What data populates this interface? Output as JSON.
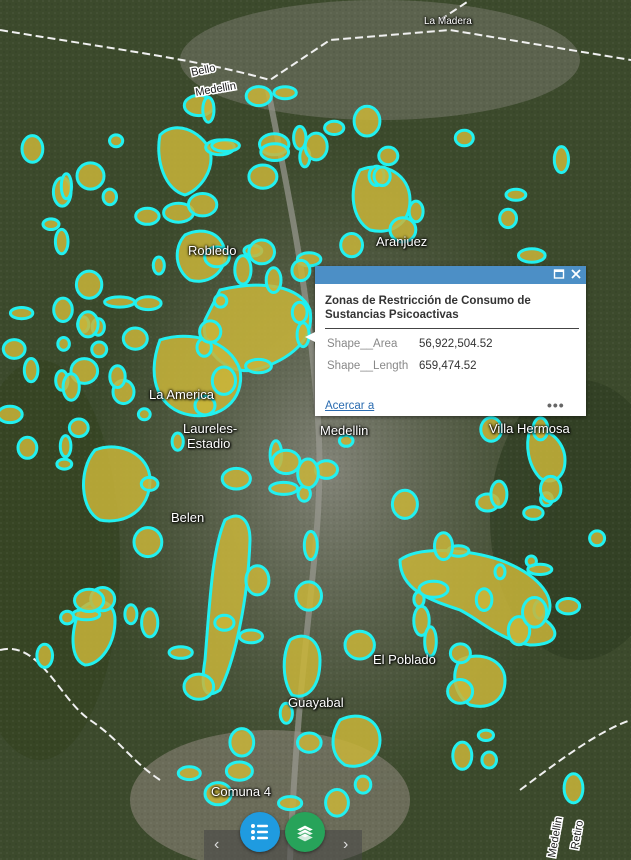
{
  "map": {
    "places": [
      {
        "id": "la-madera",
        "text": "La Madera"
      },
      {
        "id": "robledo",
        "text": "Robledo"
      },
      {
        "id": "aranjuez",
        "text": "Aranjuez"
      },
      {
        "id": "la-america",
        "text": "La America"
      },
      {
        "id": "laureles-1",
        "text": "Laureles-"
      },
      {
        "id": "laureles-2",
        "text": "Estadio"
      },
      {
        "id": "medellin",
        "text": "Medellin"
      },
      {
        "id": "villa-hermosa",
        "text": "Villa Hermosa"
      },
      {
        "id": "belen",
        "text": "Belen"
      },
      {
        "id": "el-poblado",
        "text": "El Poblado"
      },
      {
        "id": "guayabal",
        "text": "Guayabal"
      },
      {
        "id": "comuna-4",
        "text": "Comuna 4"
      }
    ],
    "roads": {
      "bello": "Bello",
      "medellin_top": "Medellin",
      "medellin_right": "Medellin",
      "retiro": "Retiro"
    },
    "colors": {
      "zone_fill": "#c9b53a",
      "zone_outline": "#22f0f0",
      "popup_header": "#4c8fc6"
    }
  },
  "popup": {
    "title": "Zonas de Restricción de Consumo de Sustancias Psicoactivas",
    "attributes": [
      {
        "key": "Shape__Area",
        "value": "56,922,504.52"
      },
      {
        "key": "Shape__Length",
        "value": "659,474.52"
      }
    ],
    "zoom_link": "Acercar a",
    "more": "•••",
    "maximize_icon": "maximize-icon",
    "close_icon": "close-icon"
  },
  "toolbar": {
    "prev": "‹",
    "next": "›",
    "legend_icon": "list-icon",
    "layers_icon": "layers-icon"
  }
}
